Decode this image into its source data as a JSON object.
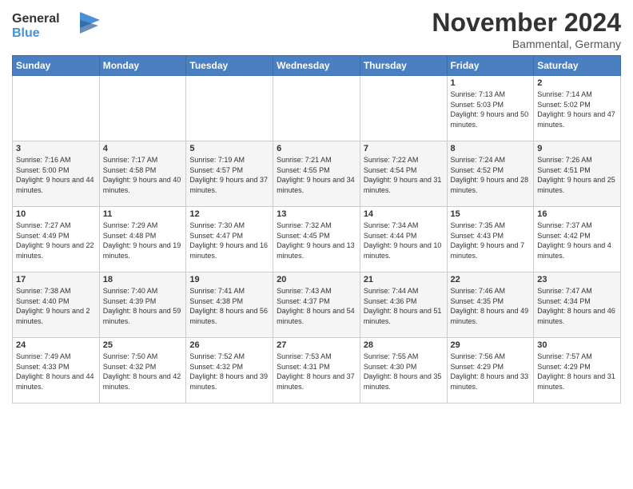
{
  "header": {
    "logo_line1": "General",
    "logo_line2": "Blue",
    "month": "November 2024",
    "location": "Bammental, Germany"
  },
  "weekdays": [
    "Sunday",
    "Monday",
    "Tuesday",
    "Wednesday",
    "Thursday",
    "Friday",
    "Saturday"
  ],
  "weeks": [
    [
      {
        "day": "",
        "info": ""
      },
      {
        "day": "",
        "info": ""
      },
      {
        "day": "",
        "info": ""
      },
      {
        "day": "",
        "info": ""
      },
      {
        "day": "",
        "info": ""
      },
      {
        "day": "1",
        "info": "Sunrise: 7:13 AM\nSunset: 5:03 PM\nDaylight: 9 hours and 50 minutes."
      },
      {
        "day": "2",
        "info": "Sunrise: 7:14 AM\nSunset: 5:02 PM\nDaylight: 9 hours and 47 minutes."
      }
    ],
    [
      {
        "day": "3",
        "info": "Sunrise: 7:16 AM\nSunset: 5:00 PM\nDaylight: 9 hours and 44 minutes."
      },
      {
        "day": "4",
        "info": "Sunrise: 7:17 AM\nSunset: 4:58 PM\nDaylight: 9 hours and 40 minutes."
      },
      {
        "day": "5",
        "info": "Sunrise: 7:19 AM\nSunset: 4:57 PM\nDaylight: 9 hours and 37 minutes."
      },
      {
        "day": "6",
        "info": "Sunrise: 7:21 AM\nSunset: 4:55 PM\nDaylight: 9 hours and 34 minutes."
      },
      {
        "day": "7",
        "info": "Sunrise: 7:22 AM\nSunset: 4:54 PM\nDaylight: 9 hours and 31 minutes."
      },
      {
        "day": "8",
        "info": "Sunrise: 7:24 AM\nSunset: 4:52 PM\nDaylight: 9 hours and 28 minutes."
      },
      {
        "day": "9",
        "info": "Sunrise: 7:26 AM\nSunset: 4:51 PM\nDaylight: 9 hours and 25 minutes."
      }
    ],
    [
      {
        "day": "10",
        "info": "Sunrise: 7:27 AM\nSunset: 4:49 PM\nDaylight: 9 hours and 22 minutes."
      },
      {
        "day": "11",
        "info": "Sunrise: 7:29 AM\nSunset: 4:48 PM\nDaylight: 9 hours and 19 minutes."
      },
      {
        "day": "12",
        "info": "Sunrise: 7:30 AM\nSunset: 4:47 PM\nDaylight: 9 hours and 16 minutes."
      },
      {
        "day": "13",
        "info": "Sunrise: 7:32 AM\nSunset: 4:45 PM\nDaylight: 9 hours and 13 minutes."
      },
      {
        "day": "14",
        "info": "Sunrise: 7:34 AM\nSunset: 4:44 PM\nDaylight: 9 hours and 10 minutes."
      },
      {
        "day": "15",
        "info": "Sunrise: 7:35 AM\nSunset: 4:43 PM\nDaylight: 9 hours and 7 minutes."
      },
      {
        "day": "16",
        "info": "Sunrise: 7:37 AM\nSunset: 4:42 PM\nDaylight: 9 hours and 4 minutes."
      }
    ],
    [
      {
        "day": "17",
        "info": "Sunrise: 7:38 AM\nSunset: 4:40 PM\nDaylight: 9 hours and 2 minutes."
      },
      {
        "day": "18",
        "info": "Sunrise: 7:40 AM\nSunset: 4:39 PM\nDaylight: 8 hours and 59 minutes."
      },
      {
        "day": "19",
        "info": "Sunrise: 7:41 AM\nSunset: 4:38 PM\nDaylight: 8 hours and 56 minutes."
      },
      {
        "day": "20",
        "info": "Sunrise: 7:43 AM\nSunset: 4:37 PM\nDaylight: 8 hours and 54 minutes."
      },
      {
        "day": "21",
        "info": "Sunrise: 7:44 AM\nSunset: 4:36 PM\nDaylight: 8 hours and 51 minutes."
      },
      {
        "day": "22",
        "info": "Sunrise: 7:46 AM\nSunset: 4:35 PM\nDaylight: 8 hours and 49 minutes."
      },
      {
        "day": "23",
        "info": "Sunrise: 7:47 AM\nSunset: 4:34 PM\nDaylight: 8 hours and 46 minutes."
      }
    ],
    [
      {
        "day": "24",
        "info": "Sunrise: 7:49 AM\nSunset: 4:33 PM\nDaylight: 8 hours and 44 minutes."
      },
      {
        "day": "25",
        "info": "Sunrise: 7:50 AM\nSunset: 4:32 PM\nDaylight: 8 hours and 42 minutes."
      },
      {
        "day": "26",
        "info": "Sunrise: 7:52 AM\nSunset: 4:32 PM\nDaylight: 8 hours and 39 minutes."
      },
      {
        "day": "27",
        "info": "Sunrise: 7:53 AM\nSunset: 4:31 PM\nDaylight: 8 hours and 37 minutes."
      },
      {
        "day": "28",
        "info": "Sunrise: 7:55 AM\nSunset: 4:30 PM\nDaylight: 8 hours and 35 minutes."
      },
      {
        "day": "29",
        "info": "Sunrise: 7:56 AM\nSunset: 4:29 PM\nDaylight: 8 hours and 33 minutes."
      },
      {
        "day": "30",
        "info": "Sunrise: 7:57 AM\nSunset: 4:29 PM\nDaylight: 8 hours and 31 minutes."
      }
    ]
  ]
}
